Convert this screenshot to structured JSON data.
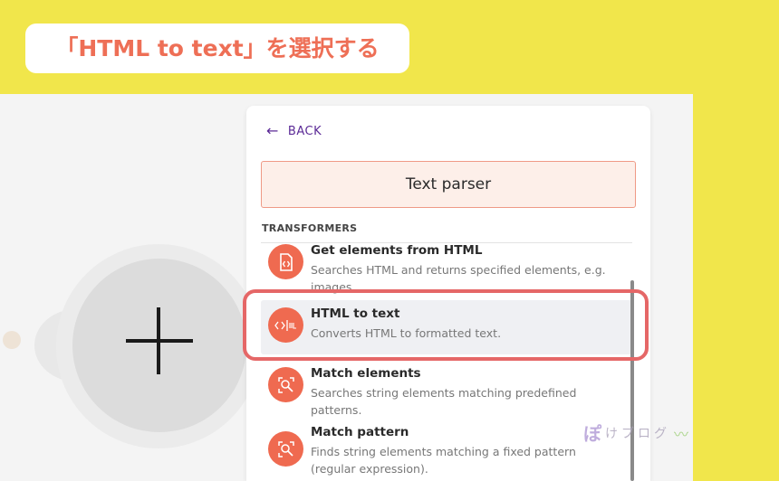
{
  "banner": {
    "text": "「HTML to text」を選択する"
  },
  "panel": {
    "back_label": "BACK",
    "title": "Text parser",
    "section_label": "TRANSFORMERS"
  },
  "items": [
    {
      "title": "Get elements from HTML",
      "desc": "Searches HTML and returns specified elements, e.g. images.",
      "icon": "code-file-icon"
    },
    {
      "title": "HTML to text",
      "desc": "Converts HTML to formatted text.",
      "icon": "html-to-text-icon",
      "selected": true
    },
    {
      "title": "Match elements",
      "desc": "Searches string elements matching predefined patterns.",
      "icon": "magnify-icon"
    },
    {
      "title": "Match pattern",
      "desc": "Finds string elements matching a fixed pattern (regular expression).",
      "icon": "magnify-icon"
    }
  ],
  "watermark": {
    "logo": "ぽ",
    "text": "けブログ"
  },
  "colors": {
    "accent": "#ef6a50",
    "highlight": "#e56767",
    "back": "#5b2a96",
    "background": "#f1e64b"
  }
}
